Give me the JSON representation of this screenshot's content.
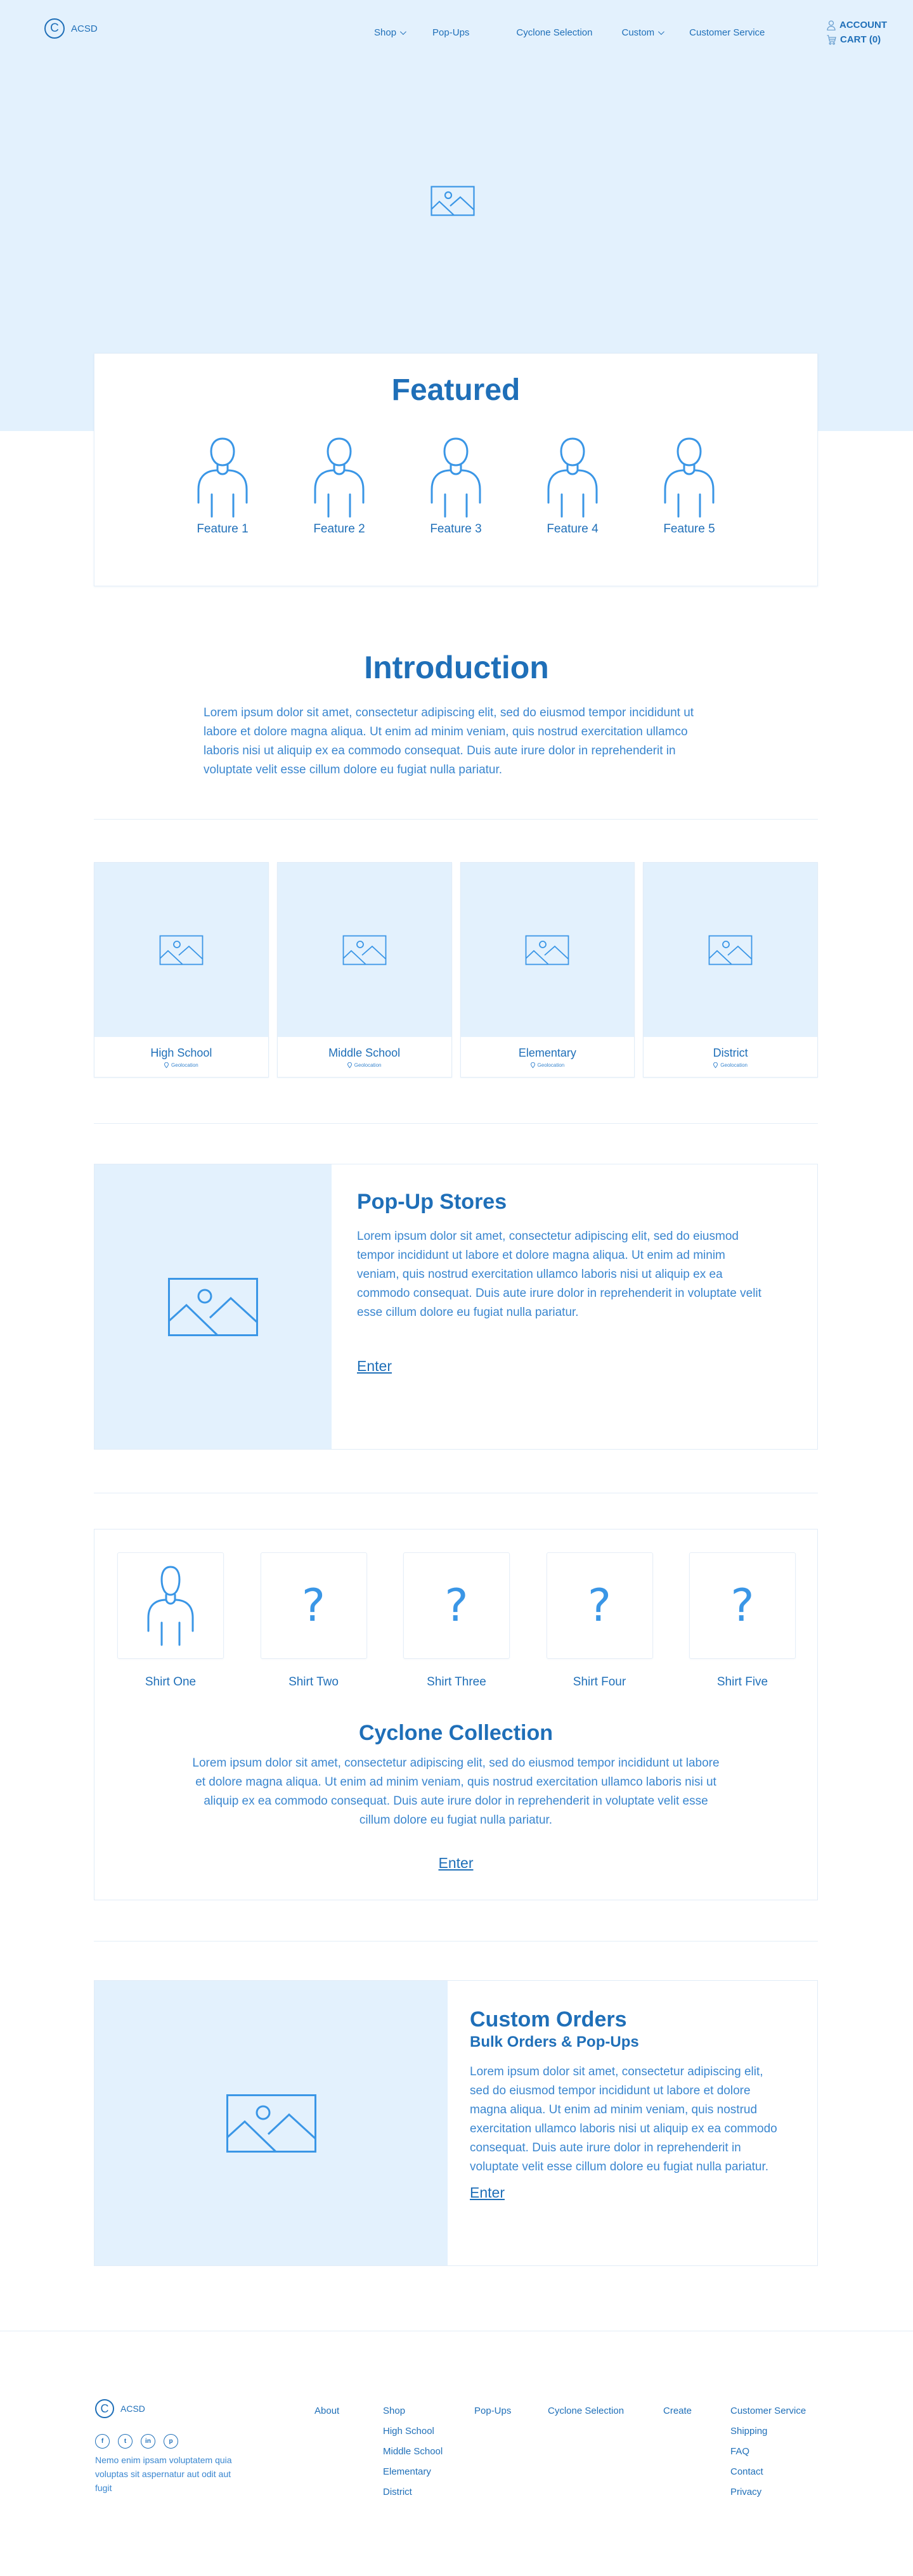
{
  "brand": {
    "logo_glyph": "C",
    "name": "ACSD"
  },
  "nav": {
    "items": [
      {
        "label": "Shop",
        "dropdown": true
      },
      {
        "label": "Pop-Ups",
        "dropdown": false
      },
      {
        "label": "Cyclone Selection",
        "dropdown": false
      },
      {
        "label": "Custom",
        "dropdown": true
      },
      {
        "label": "Customer Service",
        "dropdown": false
      }
    ],
    "account_label": "ACCOUNT",
    "cart_label": "CART (0)"
  },
  "hero": {
    "image_icon": "image-placeholder-icon"
  },
  "featured": {
    "title": "Featured",
    "items": [
      {
        "label": "Feature 1",
        "icon": "person-icon"
      },
      {
        "label": "Feature 2",
        "icon": "person-icon"
      },
      {
        "label": "Feature 3",
        "icon": "person-icon"
      },
      {
        "label": "Feature 4",
        "icon": "person-icon"
      },
      {
        "label": "Feature 5",
        "icon": "person-icon"
      }
    ]
  },
  "intro": {
    "title": "Introduction",
    "text": "Lorem ipsum dolor sit amet, consectetur adipiscing elit, sed do eiusmod tempor incididunt ut labore et dolore magna aliqua. Ut enim ad minim veniam, quis nostrud exercitation ullamco laboris nisi ut aliquip ex ea commodo consequat. Duis aute irure dolor in reprehenderit in voluptate velit esse cillum dolore eu fugiat nulla pariatur."
  },
  "schools": [
    {
      "name": "High School",
      "location": "Geolocation"
    },
    {
      "name": "Middle School",
      "location": "Geolocation"
    },
    {
      "name": "Elementary",
      "location": "Geolocation"
    },
    {
      "name": "District",
      "location": "Geolocation"
    }
  ],
  "popup": {
    "title": "Pop-Up Stores",
    "text": "Lorem ipsum dolor sit amet, consectetur adipiscing elit, sed do eiusmod tempor incididunt ut labore et dolore magna aliqua. Ut enim ad minim veniam, quis nostrud exercitation ullamco laboris nisi ut aliquip ex ea commodo consequat. Duis aute irure dolor in reprehenderit in voluptate velit esse cillum dolore eu fugiat nulla pariatur.",
    "link": "Enter"
  },
  "cyclone": {
    "shirts": [
      {
        "label": "Shirt One",
        "type": "person"
      },
      {
        "label": "Shirt Two",
        "type": "unknown",
        "glyph": "?"
      },
      {
        "label": "Shirt Three",
        "type": "unknown",
        "glyph": "?"
      },
      {
        "label": "Shirt Four",
        "type": "unknown",
        "glyph": "?"
      },
      {
        "label": "Shirt Five",
        "type": "unknown",
        "glyph": "?"
      }
    ],
    "title": "Cyclone Collection",
    "text": "Lorem ipsum dolor sit amet, consectetur adipiscing elit, sed do eiusmod tempor incididunt ut labore et dolore magna aliqua. Ut enim ad minim veniam, quis nostrud exercitation ullamco laboris nisi ut aliquip ex ea commodo consequat. Duis aute irure dolor in reprehenderit in voluptate velit esse cillum dolore eu fugiat nulla pariatur.",
    "link": "Enter"
  },
  "custom": {
    "title": "Custom Orders",
    "subtitle": "Bulk Orders & Pop-Ups",
    "text": "Lorem ipsum dolor sit amet, consectetur adipiscing elit, sed do eiusmod tempor incididunt ut labore et dolore magna aliqua. Ut enim ad minim veniam, quis nostrud exercitation ullamco laboris nisi ut aliquip ex ea commodo consequat. Duis aute irure dolor in reprehenderit in voluptate velit esse cillum dolore eu fugiat nulla pariatur.",
    "link": "Enter"
  },
  "footer": {
    "brand": "ACSD",
    "logo_glyph": "C",
    "socials": [
      {
        "name": "facebook",
        "glyph": "f"
      },
      {
        "name": "twitter",
        "glyph": "t"
      },
      {
        "name": "linkedin",
        "glyph": "in"
      },
      {
        "name": "pinterest",
        "glyph": "p"
      }
    ],
    "text": "Nemo enim ipsam voluptatem quia voluptas sit aspernatur aut odit aut fugit",
    "columns": [
      {
        "heading": "About",
        "links": []
      },
      {
        "heading": "Shop",
        "links": [
          "High School",
          "Middle School",
          "Elementary",
          "District"
        ]
      },
      {
        "heading": "Pop-Ups",
        "links": []
      },
      {
        "heading": "Cyclone Selection",
        "links": []
      },
      {
        "heading": "Create",
        "links": []
      },
      {
        "heading": "Customer Service",
        "links": [
          "Shipping",
          "FAQ",
          "Contact",
          "Privacy"
        ]
      }
    ]
  },
  "colors": {
    "primary": "#1f6fb8",
    "text": "#3a86cf",
    "icon": "#3a96e6",
    "tint": "#e3f1fd",
    "border": "#e1ecf7"
  }
}
